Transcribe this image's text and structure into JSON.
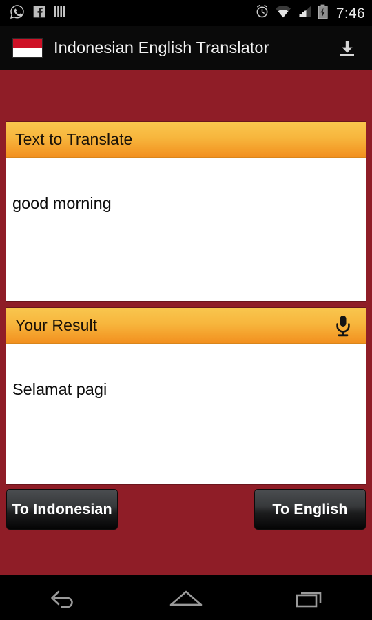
{
  "status_bar": {
    "icons": [
      "whatsapp-icon",
      "facebook-icon",
      "barcode-icon",
      "alarm-icon",
      "wifi-icon",
      "signal-icon",
      "battery-charging-icon"
    ],
    "time": "7:46"
  },
  "app_bar": {
    "flag": "indonesia-flag-icon",
    "flag_colors": {
      "red": "#CE1126",
      "white": "#FFFFFF"
    },
    "title": "Indonesian English Translator",
    "action_icon": "download-icon"
  },
  "theme": {
    "background_red": "#8F1D27",
    "header_orange_top": "#F9C64E",
    "header_orange_bottom": "#F2901F",
    "card_white": "#FFFFFF",
    "button_dark": "#1C1D1E"
  },
  "cards": {
    "input": {
      "title": "Text to Translate",
      "value": "good morning",
      "placeholder": "Text to Translate"
    },
    "result": {
      "title": "Your Result",
      "value": "Selamat pagi",
      "placeholder": "Your Result",
      "action_icon": "microphone-icon"
    }
  },
  "buttons": {
    "to_indonesian": "To Indonesian",
    "to_english": "To English"
  },
  "nav_bar": {
    "back": "back-icon",
    "home": "home-icon",
    "recents": "recents-icon"
  }
}
